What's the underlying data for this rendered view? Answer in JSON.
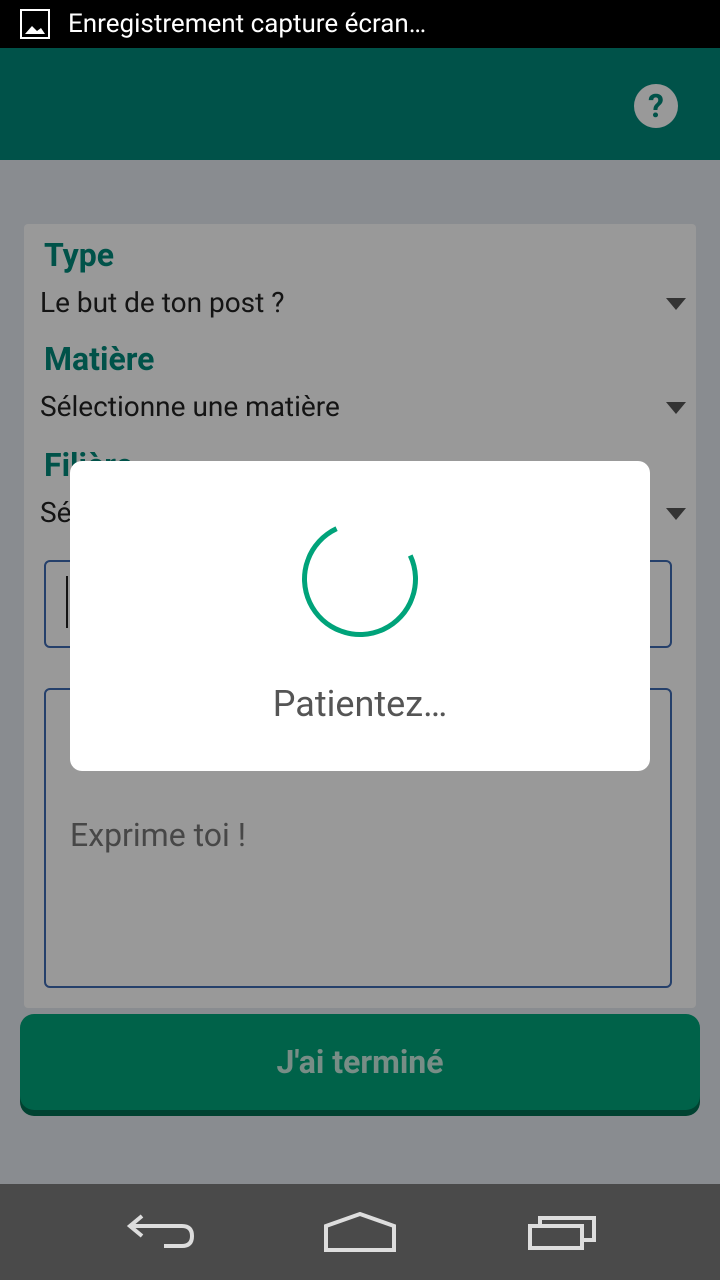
{
  "status_bar": {
    "notification_text": "Enregistrement capture écran…"
  },
  "form": {
    "type_label": "Type",
    "type_value": "Le but de ton post ?",
    "matiere_label": "Matière",
    "matiere_value": "Sélectionne une matière",
    "filiere_label": "Filière",
    "filiere_value": "Sé",
    "message_placeholder": "Exprime toi !",
    "submit_label": "J'ai terminé"
  },
  "dialog": {
    "message": "Patientez…"
  },
  "colors": {
    "primary": "#00897b",
    "accent": "#00a37a",
    "input_border": "#3f6bb3"
  },
  "icons": {
    "status": "image-icon",
    "help": "help-icon",
    "back": "back-icon",
    "home": "home-icon",
    "recents": "recents-icon"
  }
}
